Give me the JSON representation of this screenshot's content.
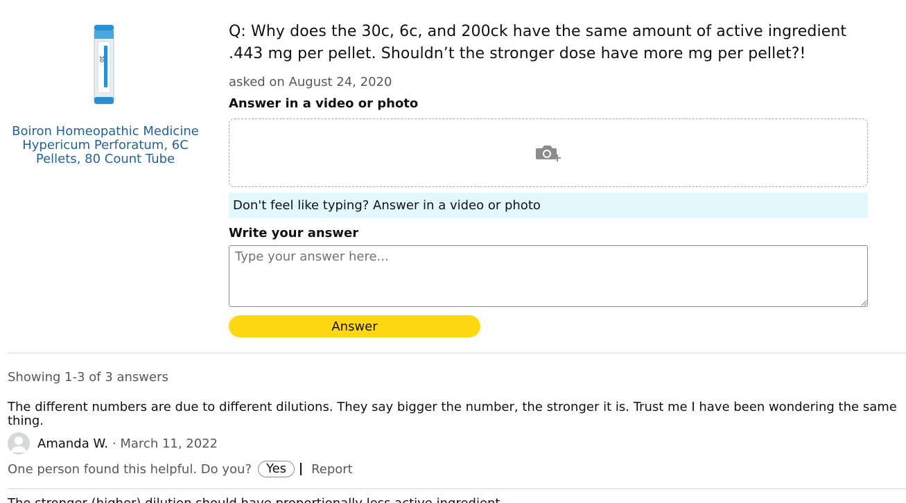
{
  "product": {
    "title": "Boiron Homeopathic Medicine Hypericum Perforatum, 6C Pellets, 80 Count Tube",
    "image_icon": "medicine-tube-image"
  },
  "question": {
    "text": "Q: Why does the 30c, 6c, and 200ck have the same amount of active ingredient .443 mg per pellet. Shouldn’t the stronger dose have more mg per pellet?!",
    "asked": "asked on August 24, 2020"
  },
  "answer_form": {
    "media_label": "Answer in a video or photo",
    "upload_icon": "camera-plus-icon",
    "typing_banner": "Don't feel like typing? Answer in a video or photo",
    "write_label": "Write your answer",
    "placeholder": "Type your answer here...",
    "submit_label": "Answer"
  },
  "answers": {
    "showing": "Showing 1-3 of 3 answers",
    "items": [
      {
        "text": "The different numbers are due to different dilutions. They say bigger the number, the stronger it is. Trust me I have been wondering the same thing.",
        "author": "Amanda W.",
        "date": "· March 11, 2022",
        "helpful": "One person found this helpful. Do you?",
        "yes_label": "Yes",
        "report_label": "Report"
      }
    ],
    "next_preview": "The stronger (higher) dilution should have proportionally less active ingredient"
  },
  "colors": {
    "link": "#2162a1",
    "button_yellow": "#ffd814",
    "banner_bg": "#e3f8fc",
    "muted_text": "#565959"
  }
}
